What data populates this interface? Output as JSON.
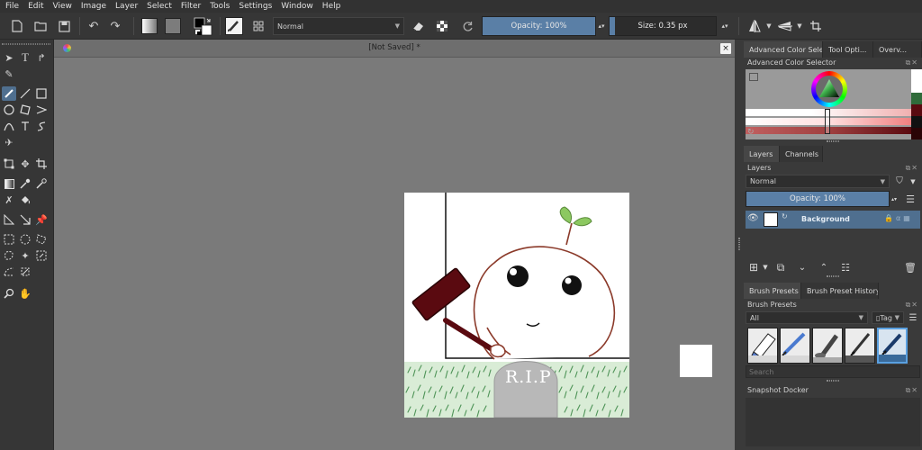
{
  "menu": [
    "File",
    "Edit",
    "View",
    "Image",
    "Layer",
    "Select",
    "Filter",
    "Tools",
    "Settings",
    "Window",
    "Help"
  ],
  "toolbar": {
    "blend_mode": "Normal",
    "opacity_label": "Opacity: 100%",
    "opacity_value": 100,
    "size_label": "Size: 0.35 px"
  },
  "document": {
    "title": "[Not Saved]  *",
    "close_symbol": "×",
    "artwork_text": "R.I.P"
  },
  "color_selector": {
    "tabs": [
      "Advanced Color Sele...",
      "Tool Opti...",
      "Overv..."
    ],
    "panel_title": "Advanced Color Selector"
  },
  "layers": {
    "tabs": [
      "Layers",
      "Channels"
    ],
    "panel_title": "Layers",
    "blend_mode": "Normal",
    "opacity_label": "Opacity:  100%",
    "layer_name": "Background"
  },
  "brush_presets": {
    "tabs": [
      "Brush Presets",
      "Brush Preset History"
    ],
    "panel_title": "Brush Presets",
    "filter_value": "All",
    "tag_label": "Tag",
    "search_placeholder": "Search"
  },
  "snapshot": {
    "panel_title": "Snapshot Docker"
  },
  "colors": {
    "accent": "#5a7fa6",
    "selected_layer": "#4f6f8f",
    "canvas_bg": "#7a7a7a",
    "hammer": "#5a0a10",
    "stroke": "#8b3a2a",
    "grass": "#3f8a4a",
    "tombstone": "#b8b8b8",
    "sprout": "#8cc860"
  }
}
